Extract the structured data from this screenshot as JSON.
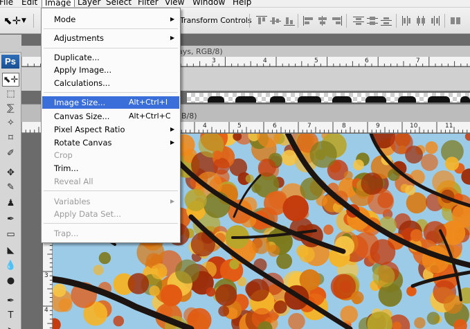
{
  "menubar": {
    "items": [
      "File",
      "Edit",
      "Image",
      "Layer",
      "Select",
      "Filter",
      "View",
      "Window",
      "Help"
    ]
  },
  "options_bar": {
    "transform_controls_label": "Transform Controls"
  },
  "tools": {
    "logo": "Ps"
  },
  "documents": {
    "doc1_title_fragment": "ays, RGB/8)",
    "doc2_title_fragment": "B/8)",
    "ruler1_numbers": [
      "3",
      "4",
      "5",
      "6",
      "7",
      "8",
      "9",
      "10",
      "11"
    ],
    "ruler2_numbers": [
      "4",
      "5",
      "6",
      "7",
      "8",
      "9",
      "10",
      "11"
    ],
    "left_ruler_numbers": [
      "1",
      "2",
      "3",
      "4"
    ]
  },
  "image_menu": {
    "mode": "Mode",
    "adjustments": "Adjustments",
    "duplicate": "Duplicate...",
    "apply_image": "Apply Image...",
    "calculations": "Calculations...",
    "image_size": "Image Size...",
    "image_size_shortcut": "Alt+Ctrl+I",
    "canvas_size": "Canvas Size...",
    "canvas_size_shortcut": "Alt+Ctrl+C",
    "pixel_aspect_ratio": "Pixel Aspect Ratio",
    "rotate_canvas": "Rotate Canvas",
    "crop": "Crop",
    "trim": "Trim...",
    "reveal_all": "Reveal All",
    "variables": "Variables",
    "apply_data_set": "Apply Data Set...",
    "trap": "Trap..."
  }
}
